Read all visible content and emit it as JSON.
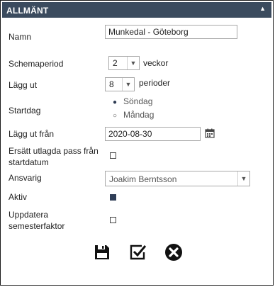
{
  "panel": {
    "title": "ALLMÄNT",
    "collapse_icon": "triangle-up-icon"
  },
  "form": {
    "name_label": "Namn",
    "name_value": "Munkedal - Göteborg",
    "schedule_period_label": "Schemaperiod",
    "schedule_period_value": "2",
    "schedule_period_unit": "veckor",
    "lay_out_label": "Lägg ut",
    "lay_out_value": "8",
    "lay_out_unit": "perioder",
    "startday_label": "Startdag",
    "startday_options": [
      "Söndag",
      "Måndag"
    ],
    "startday_selected": "Söndag",
    "lay_out_from_label": "Lägg ut från",
    "lay_out_from_value": "2020-08-30",
    "replace_label_line1": "Ersätt utlagda pass från",
    "replace_label_line2": "startdatum",
    "replace_checked": false,
    "responsible_label": "Ansvarig",
    "responsible_value": "Joakim Berntsson",
    "active_label": "Aktiv",
    "active_checked": true,
    "update_label_line1": "Uppdatera",
    "update_label_line2": "semesterfaktor",
    "update_checked": false
  },
  "actions": {
    "save_icon": "save-icon",
    "approve_icon": "checkbox-edit-icon",
    "cancel_icon": "close-circle-icon"
  },
  "colors": {
    "header_bg": "#3b4b5e",
    "accent": "#2f3e57"
  }
}
